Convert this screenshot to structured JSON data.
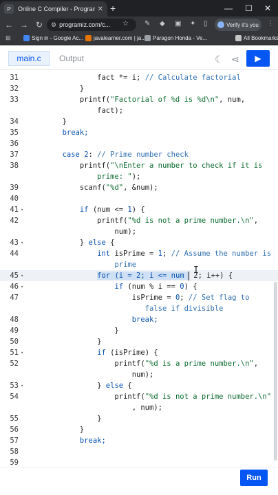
{
  "browser": {
    "tab_title": "Online C Compiler - Programiz",
    "tab_favicon": "P",
    "url": "programiz.com/c...",
    "verify_label": "Verify it's you",
    "all_bookmarks": "All Bookmarks",
    "bookmarks": [
      {
        "label": "Sign in - Google Ac...",
        "color": "#4285f4"
      },
      {
        "label": "javalearner.com | ja...",
        "color": "#e37400"
      },
      {
        "label": "Paragon Honda - Ve...",
        "color": "#9aa0a6"
      }
    ]
  },
  "header": {
    "file_tab": "main.c",
    "output_tab": "Output",
    "run_icon": "play-icon",
    "theme_icon": "moon-icon",
    "share_icon": "share-icon"
  },
  "colors": {
    "accent": "#0556f3"
  },
  "editor": {
    "highlight_line": "45",
    "lines": [
      {
        "n": "31",
        "fold": false
      },
      {
        "n": "32",
        "fold": false
      },
      {
        "n": "33",
        "fold": false
      },
      {
        "n": "",
        "fold": false
      },
      {
        "n": "34",
        "fold": false
      },
      {
        "n": "35",
        "fold": false
      },
      {
        "n": "36",
        "fold": false
      },
      {
        "n": "37",
        "fold": false
      },
      {
        "n": "38",
        "fold": false
      },
      {
        "n": "",
        "fold": false
      },
      {
        "n": "39",
        "fold": false
      },
      {
        "n": "40",
        "fold": false
      },
      {
        "n": "41",
        "fold": true
      },
      {
        "n": "42",
        "fold": false
      },
      {
        "n": "",
        "fold": false
      },
      {
        "n": "43",
        "fold": true
      },
      {
        "n": "44",
        "fold": false
      },
      {
        "n": "",
        "fold": false
      },
      {
        "n": "45",
        "fold": true
      },
      {
        "n": "46",
        "fold": true
      },
      {
        "n": "47",
        "fold": false
      },
      {
        "n": "",
        "fold": false
      },
      {
        "n": "48",
        "fold": false
      },
      {
        "n": "49",
        "fold": false
      },
      {
        "n": "50",
        "fold": false
      },
      {
        "n": "51",
        "fold": true
      },
      {
        "n": "52",
        "fold": false
      },
      {
        "n": "",
        "fold": false
      },
      {
        "n": "53",
        "fold": true
      },
      {
        "n": "54",
        "fold": false
      },
      {
        "n": "",
        "fold": false
      },
      {
        "n": "55",
        "fold": false
      },
      {
        "n": "56",
        "fold": false
      },
      {
        "n": "57",
        "fold": false
      },
      {
        "n": "58",
        "fold": false
      },
      {
        "n": "59",
        "fold": false
      }
    ],
    "code": {
      "l31": "                fact *= i; ",
      "l31c": "// Calculate factorial",
      "l32": "            }",
      "l33a": "            printf(",
      "l33s": "\"Factorial of %d is %d\\n\"",
      "l33b": ", num,",
      "l33w": "                fact);",
      "l34": "        }",
      "l35": "        break;",
      "l37k": "case ",
      "l37n": "2",
      "l37p": ": ",
      "l37c": "// Prime number check",
      "l38a": "            printf(",
      "l38s": "\"\\nEnter a number to check if it is",
      "l38w": "                prime: \"",
      "l38b": ");",
      "l39a": "            scanf(",
      "l39s": "\"%d\"",
      "l39b": ", &num);",
      "l41k": "if",
      "l41a": " (num <= ",
      "l41n": "1",
      "l41b": ") {",
      "l42a": "                printf(",
      "l42s": "\"%d is not a prime number.\\n\"",
      "l42b": ",",
      "l42w": "                    num);",
      "l43a": "            } ",
      "l43k": "else",
      "l43b": " {",
      "l44k": "int",
      "l44a": " isPrime = ",
      "l44n": "1",
      "l44b": "; ",
      "l44c": "// Assume the number is",
      "l44w": "                    prime",
      "l45sel": "for (i = 2; i <= num ",
      "l45rest": " 2; i++) {",
      "l46k": "if",
      "l46a": " (num % i == ",
      "l46n": "0",
      "l46b": ") {",
      "l47a": "                        isPrime = ",
      "l47n": "0",
      "l47b": "; ",
      "l47c": "// Set flag to",
      "l47w": "                           false if divisible",
      "l48": "                        break;",
      "l49": "                    }",
      "l50": "                }",
      "l51k": "if",
      "l51a": " (isPrime) {",
      "l52a": "                    printf(",
      "l52s": "\"%d is a prime number.\\n\"",
      "l52b": ",",
      "l52w": "                        num);",
      "l53a": "                } ",
      "l53k": "else",
      "l53b": " {",
      "l54a": "                    printf(",
      "l54s": "\"%d is not a prime number.\\n\"",
      "l54w": "                        , num);",
      "l55": "                }",
      "l56": "            }",
      "l57": "            break;"
    }
  },
  "footer": {
    "run_label": "Run"
  }
}
